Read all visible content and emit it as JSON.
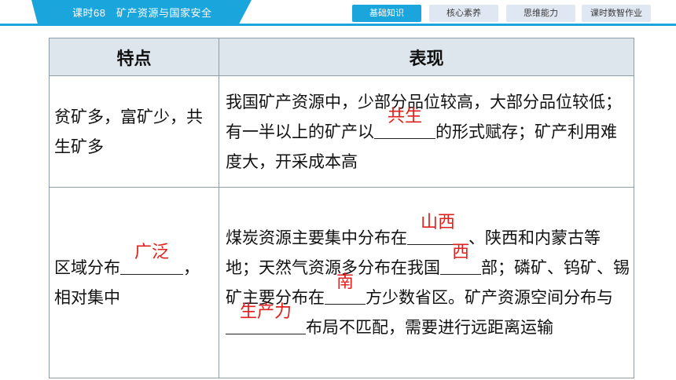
{
  "header": {
    "lesson_title": "课时68　矿产资源与国家安全",
    "tabs": [
      {
        "label": "基础知识",
        "active": true
      },
      {
        "label": "核心素养",
        "active": false
      },
      {
        "label": "思维能力",
        "active": false
      },
      {
        "label": "课时数智作业",
        "active": false
      }
    ]
  },
  "colors": {
    "accent": "#1aa6dd",
    "answer": "#e0201c",
    "header_bg": "#dde6ed"
  },
  "table": {
    "headers": [
      "特点",
      "表现"
    ],
    "row1": {
      "feature": "贫矿多，富矿少，共生矿多",
      "detail_before": "我国矿产资源中，少部分品位较高，大部分品位较低；有一半以上的矿产以",
      "answer": "共生",
      "detail_after": "的形式赋存；矿产利用难度大，开采成本高"
    },
    "row2": {
      "feature_before": "区域分布",
      "feature_answer": "广泛",
      "feature_after": "，相对集中",
      "d1": "煤炭资源主要集中分布在",
      "a1": "山西",
      "d2": "、陕西和内蒙古等地；天然气资源多分布在我国",
      "a2": "西",
      "d3": "部；磷矿、钨矿、锡矿主要分布在",
      "a3": "南",
      "d4": "方少数省区。矿产资源空间分布与",
      "a4": "生产力",
      "d5": "布局不匹配，需要进行远距离运输"
    }
  }
}
